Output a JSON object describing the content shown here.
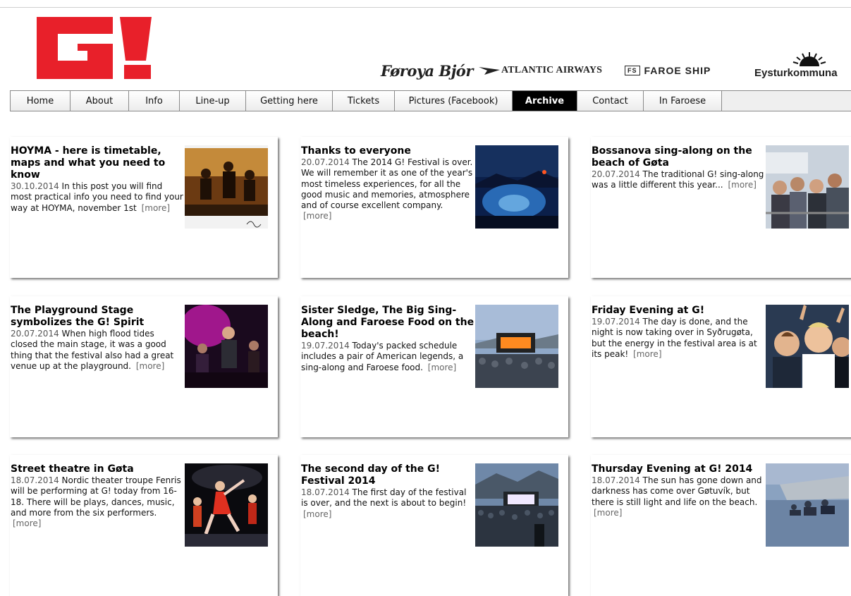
{
  "header": {
    "logo_text": "G!",
    "sponsors": {
      "foroya": "Føroya Bjór",
      "atlantic": "ATLANTIC AIRWAYS",
      "faroe_ship": "FAROE SHIP",
      "eystur": "Eysturkommuna"
    }
  },
  "nav": {
    "items": [
      {
        "label": "Home"
      },
      {
        "label": "About"
      },
      {
        "label": "Info"
      },
      {
        "label": "Line-up"
      },
      {
        "label": "Getting here"
      },
      {
        "label": "Tickets"
      },
      {
        "label": "Pictures (Facebook)"
      },
      {
        "label": "Archive"
      },
      {
        "label": "Contact"
      },
      {
        "label": "In Faroese"
      }
    ],
    "active": "Archive"
  },
  "more_label": "[more]",
  "posts": [
    {
      "title": "HOYMA - here is timetable, maps and what you need to know",
      "date": "30.10.2014",
      "excerpt": "In this post you will find most practical info you need to find your way at HOYMA, november 1st"
    },
    {
      "title": "Thanks to everyone",
      "date": "20.07.2014",
      "excerpt": "The 2014 G! Festival is over. We will remember it as one of the year's most timeless experiences, for all the good music and memories, atmosphere and of course excellent company."
    },
    {
      "title": "Bossanova sing-along on the beach of Gøta",
      "date": "20.07.2014",
      "excerpt": "The traditional G! sing-along was a little different this year..."
    },
    {
      "title": "The Playground Stage symbolizes the G! Spirit",
      "date": "20.07.2014",
      "excerpt": "When high flood tides closed the main stage, it was a good thing that the festival also had a great venue up at the playground."
    },
    {
      "title": "Sister Sledge, The Big Sing-Along and Faroese Food on the beach!",
      "date": "19.07.2014",
      "excerpt": "Today's packed schedule includes a pair of American legends, a sing-along and Faroese food."
    },
    {
      "title": "Friday Evening at G!",
      "date": "19.07.2014",
      "excerpt": "The day is done, and the night is now taking over in Syðrugøta, but the energy in the festival area is at its peak!"
    },
    {
      "title": "Street theatre in Gøta",
      "date": "18.07.2014",
      "excerpt": "Nordic theater troupe Fenris will be performing at G! today from 16-18. There will be plays, dances, music, and more from the six performers."
    },
    {
      "title": "The second day of the G! Festival 2014",
      "date": "18.07.2014",
      "excerpt": "The first day of the festival is over, and the next is about to begin!"
    },
    {
      "title": "Thursday Evening at G! 2014",
      "date": "18.07.2014",
      "excerpt": "The sun has gone down and darkness has come over Gøtuvík, but there is still light and life on the beach."
    }
  ]
}
